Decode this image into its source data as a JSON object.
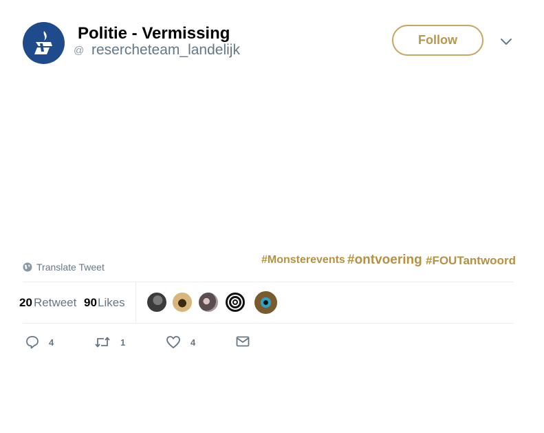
{
  "header": {
    "display_name": "Politie - Vermissing",
    "at_sign": "@",
    "handle": "resercheteam_landelijk",
    "follow_label": "Follow"
  },
  "hashtags": [
    "#Monsterevents",
    "#ontvoering",
    "#FOUTantwoord"
  ],
  "translate_label": "Translate Tweet",
  "stats": {
    "retweets": "20",
    "retweet_label": "Retweet",
    "likes": "90",
    "likes_label": "Likes"
  },
  "actions": {
    "reply_count": "4",
    "retweet_count": "1",
    "like_count": "4"
  },
  "icons": {
    "avatar": "police-logo-icon",
    "chevron": "chevron-down-icon",
    "translate": "globe-icon",
    "reply": "reply-icon",
    "retweet": "retweet-icon",
    "like": "heart-icon",
    "message": "envelope-icon"
  },
  "colors": {
    "accent_gold": "#b59140",
    "avatar_blue": "#1f4b8c",
    "muted": "#657786"
  }
}
